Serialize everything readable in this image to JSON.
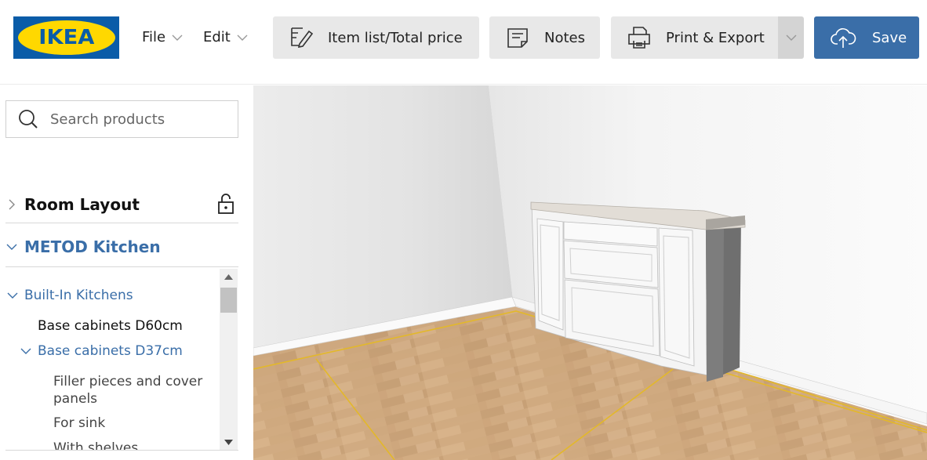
{
  "app": {
    "logo_text": "IKEA",
    "brand_blue": "#0a5ca8",
    "brand_yellow": "#ffd800",
    "accent": "#3a6ea8"
  },
  "menu": {
    "file": "File",
    "edit": "Edit"
  },
  "toolbar": {
    "item_list": "Item list/Total price",
    "notes": "Notes",
    "print_export": "Print & Export",
    "save": "Save"
  },
  "sidebar": {
    "search_placeholder": "Search products",
    "room_layout": "Room Layout",
    "section_title": "METOD Kitchen",
    "tree": {
      "built_in": "Built-In Kitchens",
      "base_d60": "Base cabinets D60cm",
      "base_d37": "Base cabinets D37cm",
      "filler_1": "Filler pieces and cover",
      "filler_2": "panels",
      "for_sink": "For sink",
      "with_shelves": "With shelves"
    }
  },
  "icons": {
    "item_list": "pencil-list-icon",
    "notes": "notes-icon",
    "print": "printer-icon",
    "save": "cloud-upload-icon",
    "search": "search-icon",
    "lock": "unlocked-padlock-icon"
  }
}
